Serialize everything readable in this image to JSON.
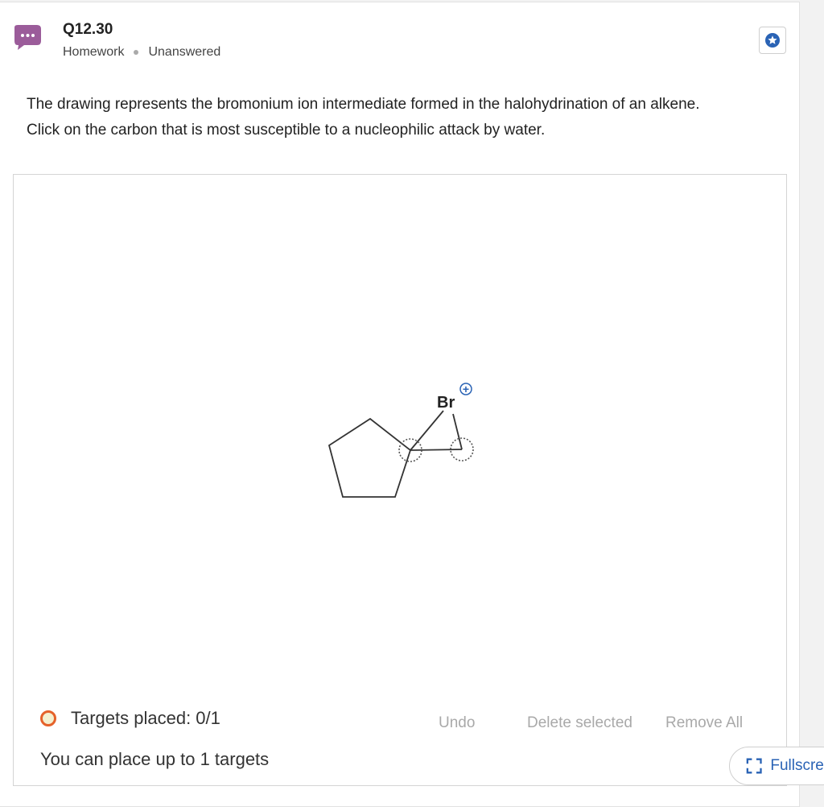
{
  "question": {
    "number": "Q12.30",
    "category": "Homework",
    "status": "Unanswered"
  },
  "prompt": {
    "line1": "The drawing represents the bromonium ion intermediate formed in the halohydrination of an alkene.",
    "line2": "Click on the carbon that is most susceptible to a nucleophilic attack by water."
  },
  "molecule": {
    "atom_label": "Br",
    "charge": "+"
  },
  "targets": {
    "placed_text": "Targets placed: 0/1",
    "hint": "You can place up to 1 targets"
  },
  "actions": {
    "undo": "Undo",
    "delete_selected": "Delete selected",
    "remove_all": "Remove All",
    "fullscreen": "Fullscreen"
  },
  "colors": {
    "avatar": "#9b5c9a",
    "star": "#2a63b5",
    "status_ring": "#e5622a",
    "disabled_text": "#a9a9a9"
  },
  "icons": {
    "avatar": "chat-bubble-icon",
    "star": "star-badge-icon",
    "fullscreen": "fullscreen-icon"
  }
}
